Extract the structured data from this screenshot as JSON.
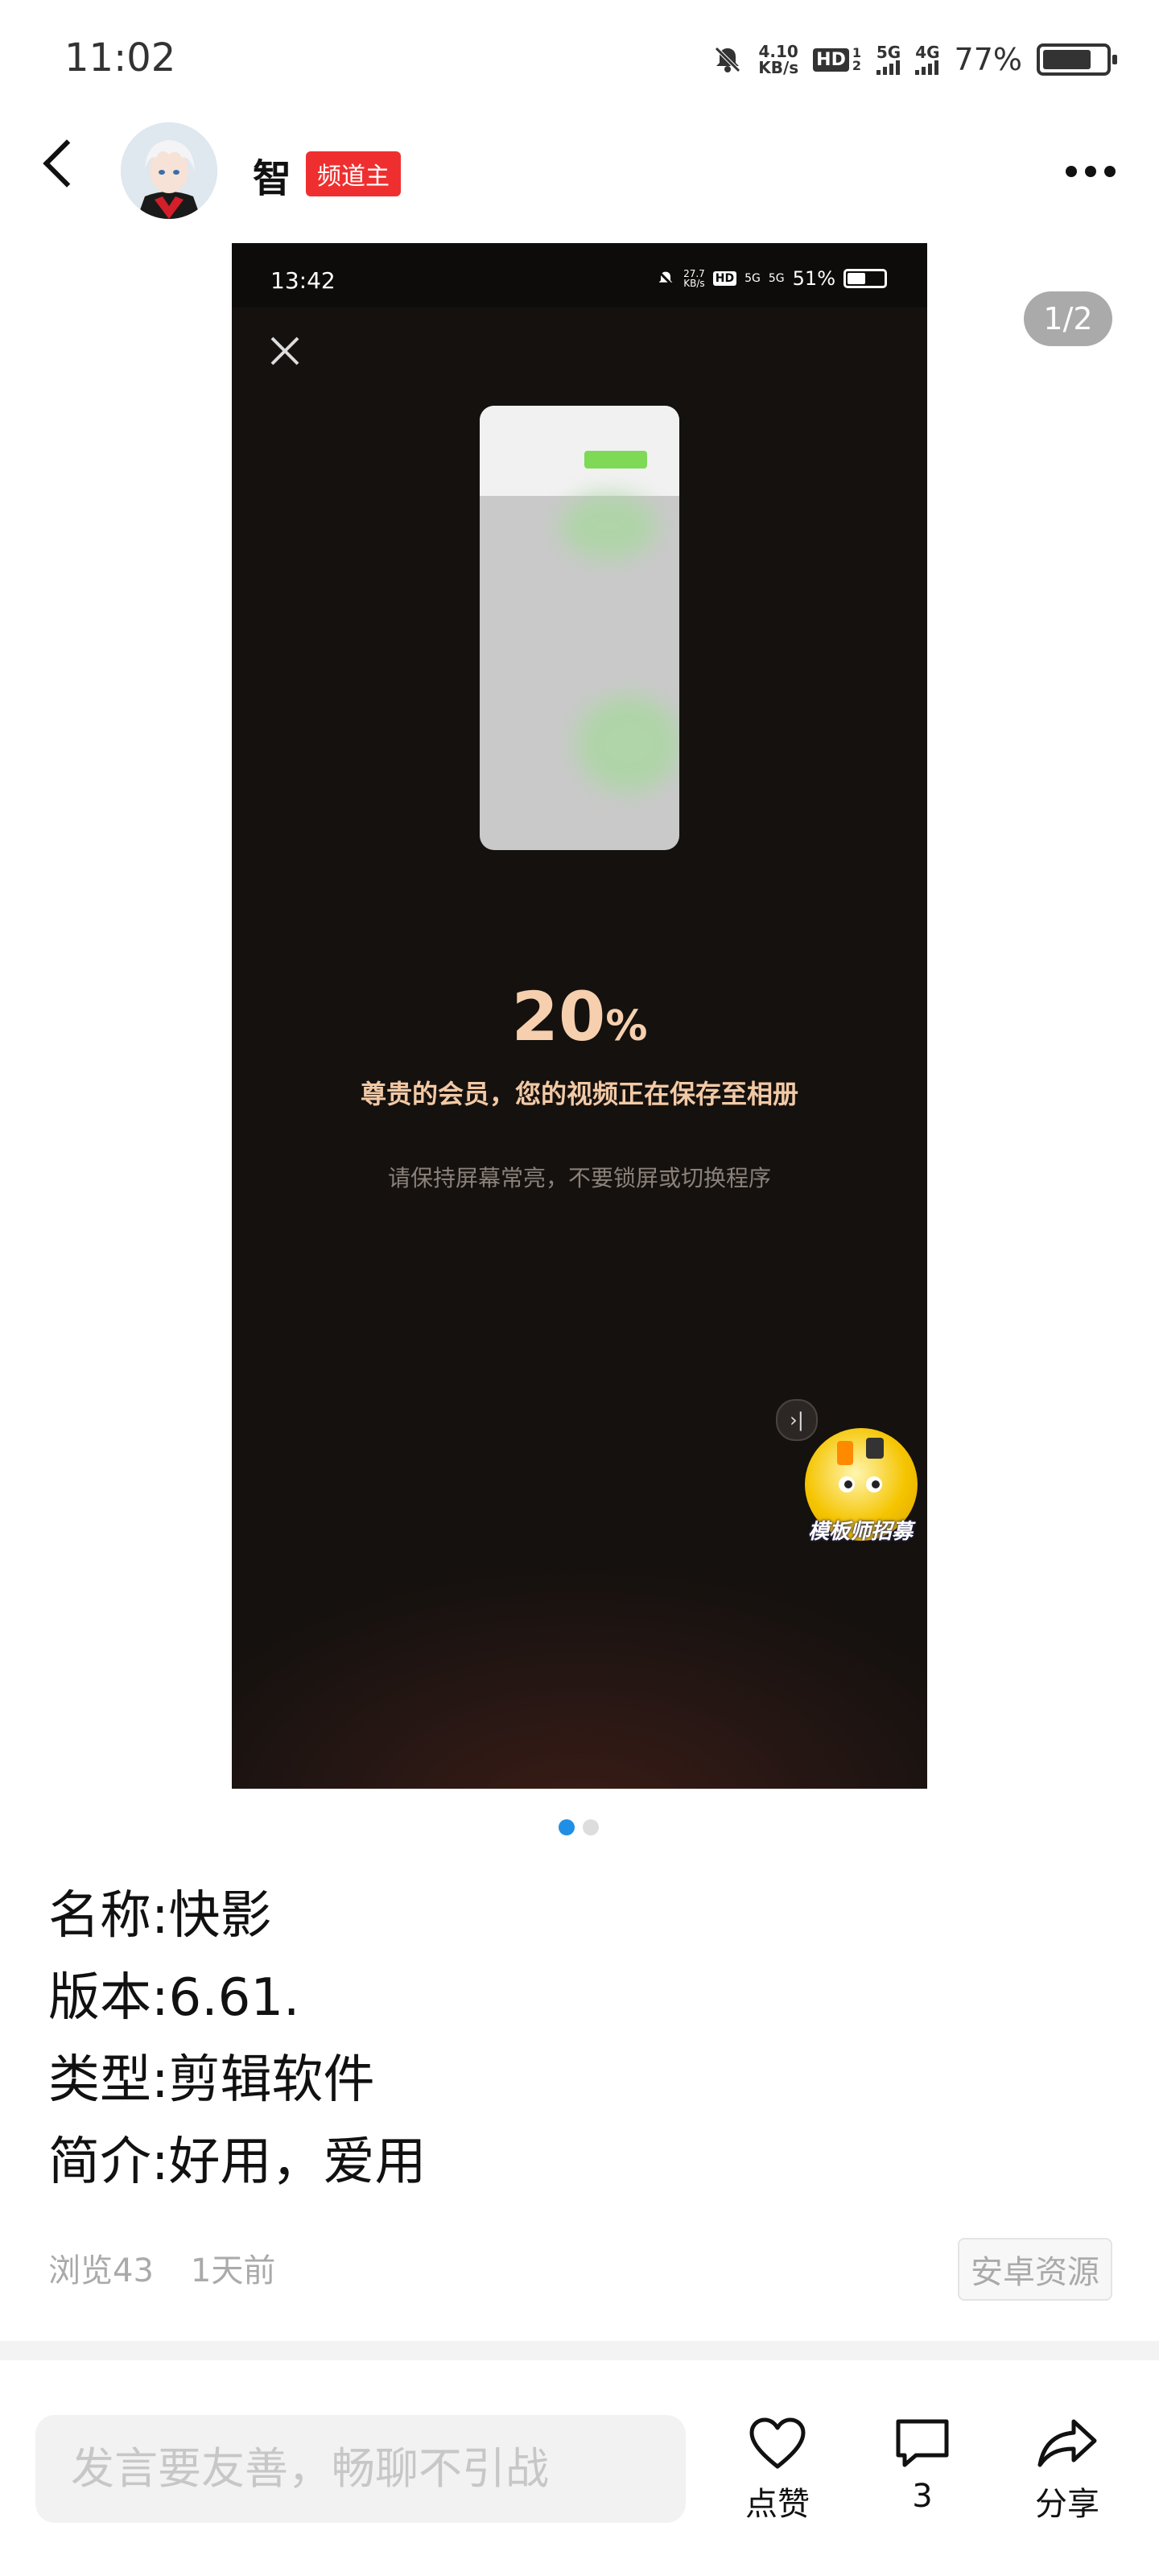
{
  "status_bar": {
    "time": "11:02",
    "net_speed_value": "4.10",
    "net_speed_unit": "KB/s",
    "hd_label": "HD",
    "hd_sub": "1 2",
    "net1": "5G",
    "net2": "4G",
    "battery_text": "77%",
    "battery_level": 0.77
  },
  "header": {
    "username": "智",
    "badge": "频道主"
  },
  "gallery": {
    "counter": "1/2",
    "active_index": 0,
    "count": 2,
    "screenshot": {
      "status_time": "13:42",
      "status_speed": "27.7",
      "status_speed_unit": "KB/s",
      "status_hd": "HD",
      "status_net1": "5G",
      "status_net2": "5G",
      "status_battery": "51%",
      "battery_level": 0.51,
      "progress_value": "20",
      "progress_unit": "%",
      "message": "尊贵的会员，您的视频正在保存至相册",
      "hint": "请保持屏幕常亮，不要锁屏或切换程序",
      "skip_glyph": "›|",
      "promo_label": "模板师招募"
    }
  },
  "post": {
    "lines": [
      "名称:快影",
      "版本:6.61.",
      "类型:剪辑软件",
      "简介:好用，爱用"
    ],
    "views": "浏览43",
    "time_ago": "1天前",
    "category": "安卓资源"
  },
  "bottom_bar": {
    "comment_placeholder": "发言要友善，畅聊不引战",
    "like_label": "点赞",
    "comment_count": "3",
    "share_label": "分享"
  },
  "icons": {
    "back": "back-arrow-icon",
    "more": "more-dots-icon",
    "close": "close-icon",
    "like": "heart-icon",
    "comment": "comment-icon",
    "share": "share-icon"
  }
}
